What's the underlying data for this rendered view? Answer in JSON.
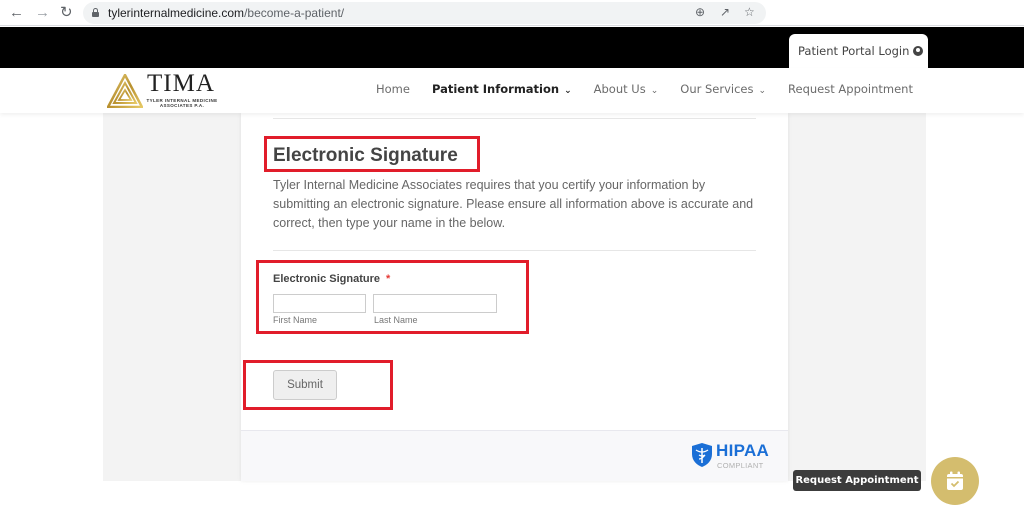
{
  "browser": {
    "url_domain": "tylerinternalmedicine.com",
    "url_path": "/become-a-patient/",
    "icons": {
      "back": "arrow-left",
      "forward": "arrow-right",
      "reload": "reload",
      "secure": "lock",
      "zoom": "magnifier-plus",
      "share": "share",
      "bookmark": "star"
    }
  },
  "topbar": {
    "portal_login": "Patient Portal Login",
    "portal_icon": "user-circle"
  },
  "header": {
    "logo_word": "TIMA",
    "logo_sub_line1": "TYLER INTERNAL MEDICINE",
    "logo_sub_line2": "ASSOCIATES P.A.",
    "nav": [
      {
        "label": "Home",
        "dropdown": false,
        "active": false
      },
      {
        "label": "Patient Information",
        "dropdown": true,
        "active": true
      },
      {
        "label": "About Us",
        "dropdown": true,
        "active": false
      },
      {
        "label": "Our Services",
        "dropdown": true,
        "active": false
      },
      {
        "label": "Request Appointment",
        "dropdown": false,
        "active": false
      }
    ]
  },
  "form": {
    "title": "Electronic Signature",
    "description": "Tyler Internal Medicine Associates requires that you certify your information by submitting an electronic signature. Please ensure all information above is accurate and correct, then type your name in the below.",
    "signature_label": "Electronic Signature",
    "required_mark": "*",
    "first_name_value": "",
    "last_name_value": "",
    "first_name_label": "First Name",
    "last_name_label": "Last Name",
    "submit_label": "Submit"
  },
  "footer": {
    "hipaa_title": "HIPAA",
    "hipaa_sub": "COMPLIANT"
  },
  "floating": {
    "tooltip": "Request Appointment",
    "fab_icon": "calendar-check"
  },
  "colors": {
    "annotation_red": "#e11d2a",
    "brand_gold": "#d4bd6e",
    "hipaa_blue": "#1b6fd6"
  }
}
